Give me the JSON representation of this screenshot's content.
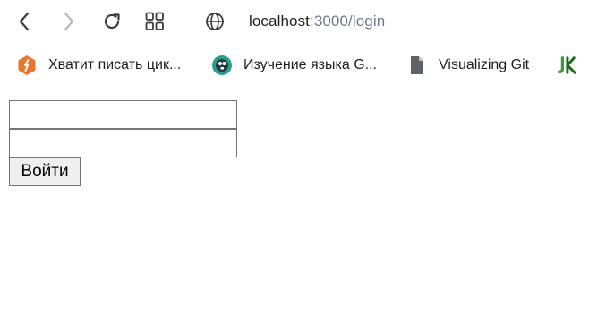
{
  "browser": {
    "toolbar": {
      "icons": [
        "back-icon",
        "forward-icon",
        "reload-icon",
        "apps-grid-icon",
        "globe-icon"
      ]
    },
    "address": {
      "host": "localhost",
      "path": ":3000/login"
    },
    "bookmarks": [
      {
        "label": "Хватит писать цик...",
        "icon": "habr-icon"
      },
      {
        "label": "Изучение языка G...",
        "icon": "gopher-icon"
      },
      {
        "label": "Visualizing Git",
        "icon": "document-icon"
      },
      {
        "label": "",
        "icon": "jk-icon"
      }
    ]
  },
  "login": {
    "username": {
      "value": "",
      "placeholder": ""
    },
    "password": {
      "value": "",
      "placeholder": ""
    },
    "submit_label": "Войти"
  },
  "colors": {
    "url_path": "#6b7a8c",
    "habr_orange": "#e8762d",
    "gopher_teal": "#2a9d8f",
    "jk_green": "#3a9a3a"
  }
}
